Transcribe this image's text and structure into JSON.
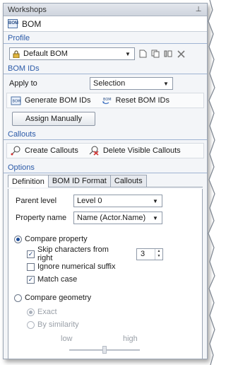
{
  "window": {
    "title": "Workshops",
    "pin_glyph": "⊥"
  },
  "header": {
    "icon": "bom-icon",
    "label": "BOM"
  },
  "profile": {
    "section_title": "Profile",
    "selected": "Default BOM",
    "lock_icon": "lock-icon",
    "tools": [
      "new-document-icon",
      "copy-document-icon",
      "columns-icon",
      "close-icon"
    ]
  },
  "bom_ids": {
    "section_title": "BOM IDs",
    "apply_to_label": "Apply to",
    "apply_to_value": "Selection",
    "generate_label": "Generate BOM IDs",
    "reset_label": "Reset BOM IDs",
    "assign_label": "Assign Manually"
  },
  "callouts": {
    "section_title": "Callouts",
    "create_label": "Create Callouts",
    "delete_label": "Delete Visible Callouts"
  },
  "options": {
    "section_title": "Options",
    "tabs": [
      {
        "label": "Definition",
        "active": true
      },
      {
        "label": "BOM ID Format",
        "active": false
      },
      {
        "label": "Callouts",
        "active": false
      }
    ],
    "parent_level_label": "Parent level",
    "parent_level_value": "Level 0",
    "property_name_label": "Property name",
    "property_name_value": "Name (Actor.Name)",
    "compare_property_label": "Compare property",
    "compare_property_selected": true,
    "skip_chars_label": "Skip characters from right",
    "skip_chars_checked": true,
    "skip_chars_value": "3",
    "ignore_suffix_label": "Ignore numerical suffix",
    "ignore_suffix_checked": false,
    "match_case_label": "Match case",
    "match_case_checked": true,
    "compare_geometry_label": "Compare geometry",
    "compare_geometry_selected": false,
    "exact_label": "Exact",
    "exact_selected": true,
    "similarity_label": "By similarity",
    "similarity_selected": false,
    "slider_low_label": "low",
    "slider_high_label": "high",
    "slider_level": 0.5
  },
  "colors": {
    "section_title": "#2b5aa8",
    "panel_bg": "#f3f5f8",
    "accent": "#1f4e9a"
  }
}
